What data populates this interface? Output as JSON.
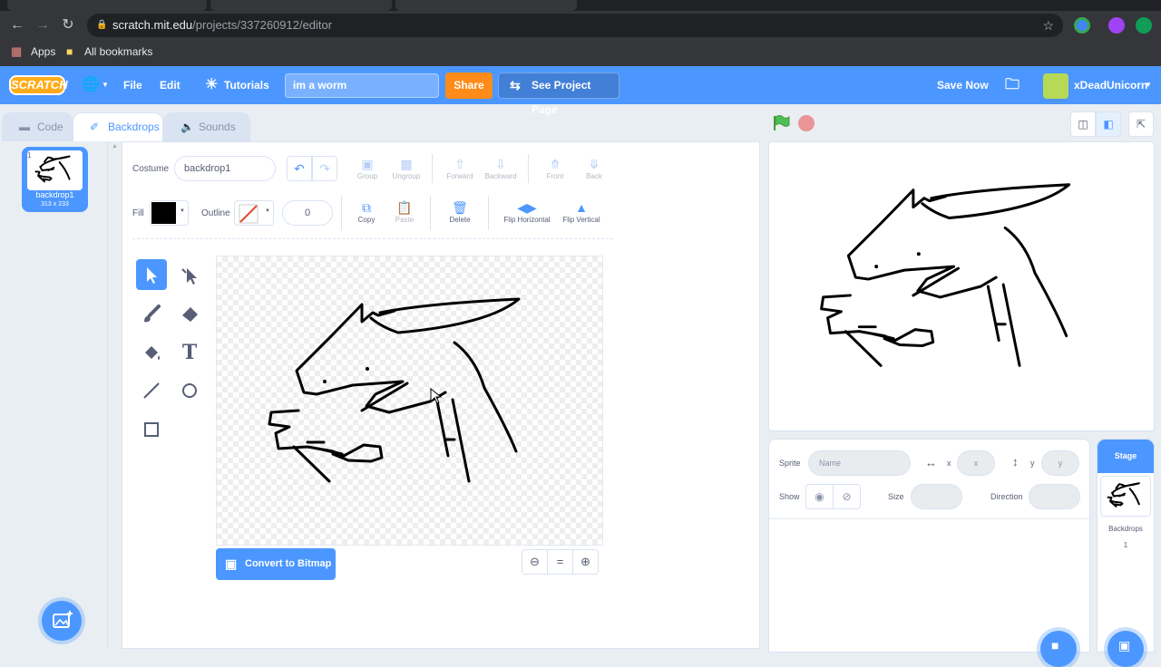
{
  "browser": {
    "url_host": "scratch.mit.edu",
    "url_path": "/projects/337260912/editor",
    "bookmarks": {
      "apps": "Apps",
      "all": "All bookmarks"
    }
  },
  "menubar": {
    "logo": "SCRATCH",
    "file": "File",
    "edit": "Edit",
    "tutorials": "Tutorials",
    "project_title": "im a worm",
    "share": "Share",
    "see_project_page": "See Project Page",
    "save_now": "Save Now",
    "username": "xDeadUnicorn"
  },
  "tabs": {
    "code": "Code",
    "backdrops": "Backdrops",
    "sounds": "Sounds"
  },
  "backdrop_list": [
    {
      "index": "1",
      "name": "backdrop1",
      "size": "313 x 233"
    }
  ],
  "paint": {
    "costume_label": "Costume",
    "costume_name": "backdrop1",
    "fill_label": "Fill",
    "outline_label": "Outline",
    "outline_width": "0",
    "fill_color": "#000000",
    "group": "Group",
    "ungroup": "Ungroup",
    "forward": "Forward",
    "backward": "Backward",
    "front": "Front",
    "back": "Back",
    "copy": "Copy",
    "paste": "Paste",
    "delete": "Delete",
    "flip_h": "Flip Horizontal",
    "flip_v": "Flip Vertical",
    "convert": "Convert to Bitmap"
  },
  "sprite_info": {
    "sprite_label": "Sprite",
    "name_placeholder": "Name",
    "x_label": "x",
    "x_placeholder": "x",
    "y_label": "y",
    "y_placeholder": "y",
    "show_label": "Show",
    "size_label": "Size",
    "direction_label": "Direction"
  },
  "stage_panel": {
    "title": "Stage",
    "backdrops_label": "Backdrops",
    "backdrops_count": "1"
  },
  "colors": {
    "accent": "#4c97ff",
    "share": "#ff8c1a",
    "flag": "#4cbf56",
    "stop": "#ec5959"
  }
}
